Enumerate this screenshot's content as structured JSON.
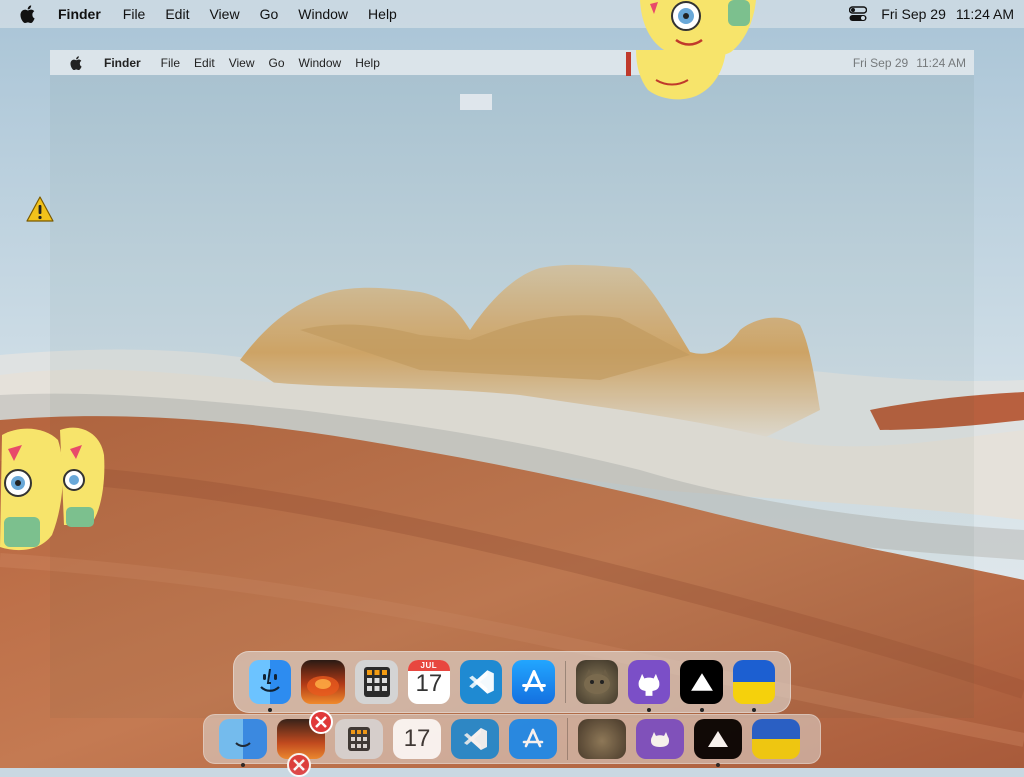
{
  "menubar": {
    "apple_icon": "apple-logo-icon",
    "app_name": "Finder",
    "menus": [
      "File",
      "Edit",
      "View",
      "Go",
      "Window",
      "Help"
    ],
    "control_center_icon": "control-center-icon",
    "date": "Fri Sep 29",
    "time": "11:24 AM"
  },
  "ghost_menubar": {
    "app_name": "Finder",
    "menus": [
      "File",
      "Edit",
      "View",
      "Go",
      "Window",
      "Help"
    ],
    "date": "Fri Sep 29",
    "time": "11:24 AM"
  },
  "dock": {
    "items": [
      {
        "name": "finder",
        "icon": "finder-icon"
      },
      {
        "name": "photo-app",
        "icon": "sunset-photo-icon"
      },
      {
        "name": "calculator",
        "icon": "calculator-icon"
      },
      {
        "name": "calendar",
        "icon": "calendar-icon",
        "month": "JUL",
        "day": "17"
      },
      {
        "name": "vscode",
        "icon": "vscode-icon"
      },
      {
        "name": "app-store",
        "icon": "app-store-icon"
      },
      {
        "name": "cat-photo",
        "icon": "cat-photo-icon"
      },
      {
        "name": "github",
        "icon": "github-icon"
      },
      {
        "name": "vercel",
        "icon": "vercel-triangle-icon"
      },
      {
        "name": "ukraine-flag",
        "icon": "ukraine-flag-icon"
      }
    ]
  },
  "colors": {
    "menubar_bg": "#d2dee6",
    "sky_top": "#aec8d8",
    "sky_bottom": "#e3eaee",
    "sand": "#b8643e",
    "rock": "#d9b47a",
    "vscode_blue": "#1f8ad2",
    "appstore_blue": "#1a8cf0",
    "github_purple": "#7b4fc7",
    "flag_blue": "#1c5fd1",
    "flag_yellow": "#f5d10c",
    "error_red": "#e03a3a"
  }
}
